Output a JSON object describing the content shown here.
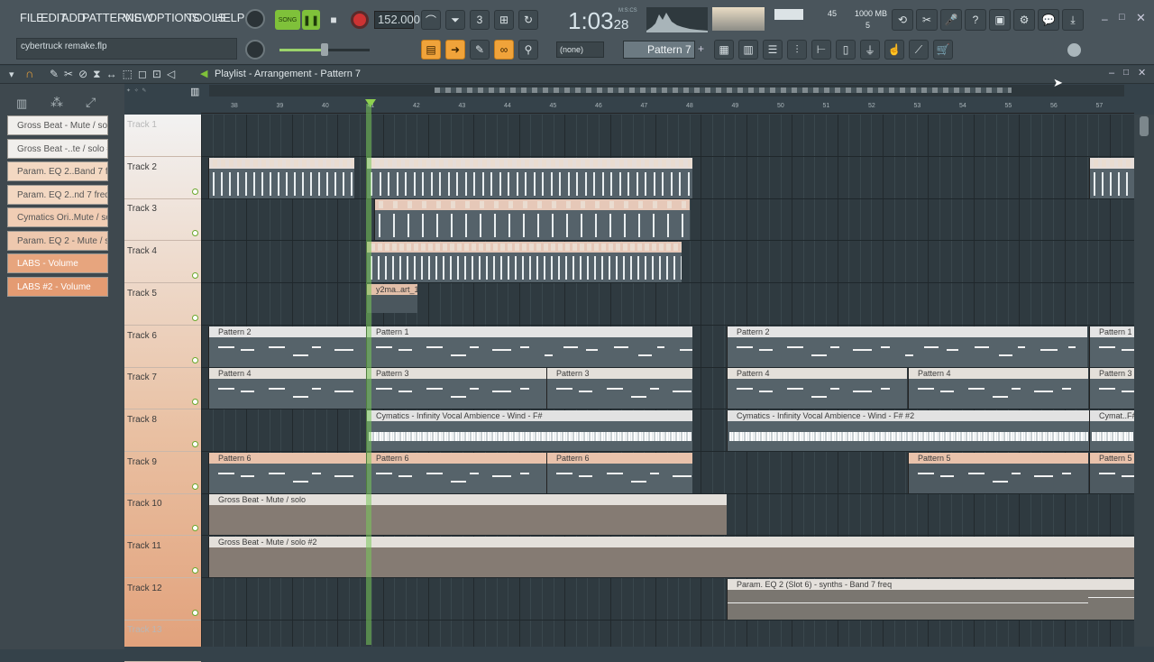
{
  "menu": [
    "FILE",
    "EDIT",
    "ADD",
    "PATTERNS",
    "VIEW",
    "OPTIONS",
    "TOOLS",
    "HELP"
  ],
  "song_mode": "SONG",
  "project_name": "cybertruck remake.flp",
  "tempo": "152.000",
  "time": {
    "main": "1:03",
    "sub": "28",
    "label": "M:S:CS"
  },
  "cpu": {
    "value": "45",
    "memory": "1000 MB",
    "voices": "5"
  },
  "snap": "(none)",
  "pattern_selector": "Pattern 7",
  "playlist": {
    "title": "Playlist - Arrangement - Pattern 7",
    "ruler": [
      "38",
      "39",
      "40",
      "41",
      "42",
      "43",
      "44",
      "45",
      "46",
      "47",
      "48",
      "49",
      "50",
      "51",
      "52",
      "53",
      "54",
      "55",
      "56",
      "57"
    ]
  },
  "clip_buttons": [
    "Gross Beat - Mute / solo",
    "Gross Beat -..te / solo #2",
    "Param. EQ 2..Band 7 freq",
    "Param. EQ 2..nd 7 freq #2",
    "Cymatics Ori..Mute / solo",
    "Param. EQ 2 - Mute / solo",
    "LABS - Volume",
    "LABS #2 - Volume"
  ],
  "tracks": [
    "Track 1",
    "Track 2",
    "Track 3",
    "Track 4",
    "Track 5",
    "Track 6",
    "Track 7",
    "Track 8",
    "Track 9",
    "Track 10",
    "Track 11",
    "Track 12",
    "Track 13"
  ],
  "clips": {
    "t5": "y2ma..art_1",
    "t6": [
      "Pattern 2",
      "Pattern 1",
      "Pattern 2",
      "Pattern 1"
    ],
    "t7": [
      "Pattern 4",
      "Pattern 3",
      "Pattern 3",
      "Pattern 4",
      "Pattern 4",
      "Pattern 3"
    ],
    "t8": [
      "Cymatics - Infinity Vocal Ambience - Wind - F#",
      "Cymatics - Infinity Vocal Ambience - Wind - F# #2",
      "Cymat..F#"
    ],
    "t9": [
      "Pattern 6",
      "Pattern 6",
      "Pattern 6",
      "Pattern 5",
      "Pattern 5"
    ],
    "t10": "Gross Beat - Mute / solo",
    "t11": "Gross Beat - Mute / solo #2",
    "t12": "Param. EQ 2 (Slot 6) - synths - Band 7 freq"
  }
}
